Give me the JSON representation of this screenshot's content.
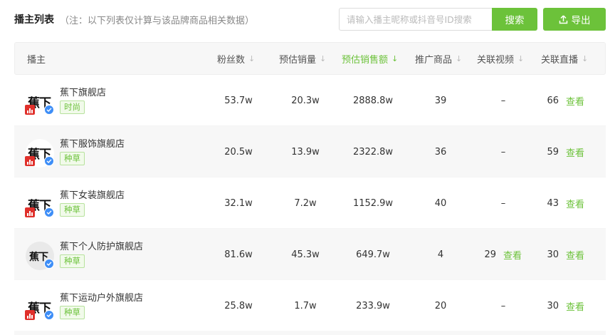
{
  "header": {
    "title": "播主列表",
    "note": "（注：以下列表仅计算与该品牌商品相关数据）",
    "search_placeholder": "请输入播主昵称或抖音号ID搜索",
    "search_button": "搜索",
    "export_button": "导出"
  },
  "colors": {
    "accent": "#6cc23a",
    "live_badge": "#e0302b",
    "verify_badge": "#3e8ef7"
  },
  "table": {
    "columns": [
      "播主",
      "粉丝数",
      "预估销量",
      "预估销售额",
      "推广商品",
      "关联视频",
      "关联直播"
    ],
    "sorted_column": "预估销售额",
    "view_label": "查看",
    "rows": [
      {
        "name": "蕉下旗舰店",
        "tag": "时尚",
        "fans": "53.7w",
        "sales": "20.3w",
        "amount": "2888.8w",
        "products": "39",
        "videos": "–",
        "live": "66"
      },
      {
        "name": "蕉下服饰旗舰店",
        "tag": "种草",
        "fans": "20.5w",
        "sales": "13.9w",
        "amount": "2322.8w",
        "products": "36",
        "videos": "–",
        "live": "59"
      },
      {
        "name": "蕉下女装旗舰店",
        "tag": "种草",
        "fans": "32.1w",
        "sales": "7.2w",
        "amount": "1152.9w",
        "products": "40",
        "videos": "–",
        "live": "43"
      },
      {
        "name": "蕉下个人防护旗舰店",
        "tag": "种草",
        "fans": "81.6w",
        "sales": "45.3w",
        "amount": "649.7w",
        "products": "4",
        "videos": "29",
        "live": "30"
      },
      {
        "name": "蕉下运动户外旗舰店",
        "tag": "种草",
        "fans": "25.8w",
        "sales": "1.7w",
        "amount": "233.9w",
        "products": "20",
        "videos": "–",
        "live": "30"
      }
    ],
    "avatar_text": "蕉下"
  }
}
